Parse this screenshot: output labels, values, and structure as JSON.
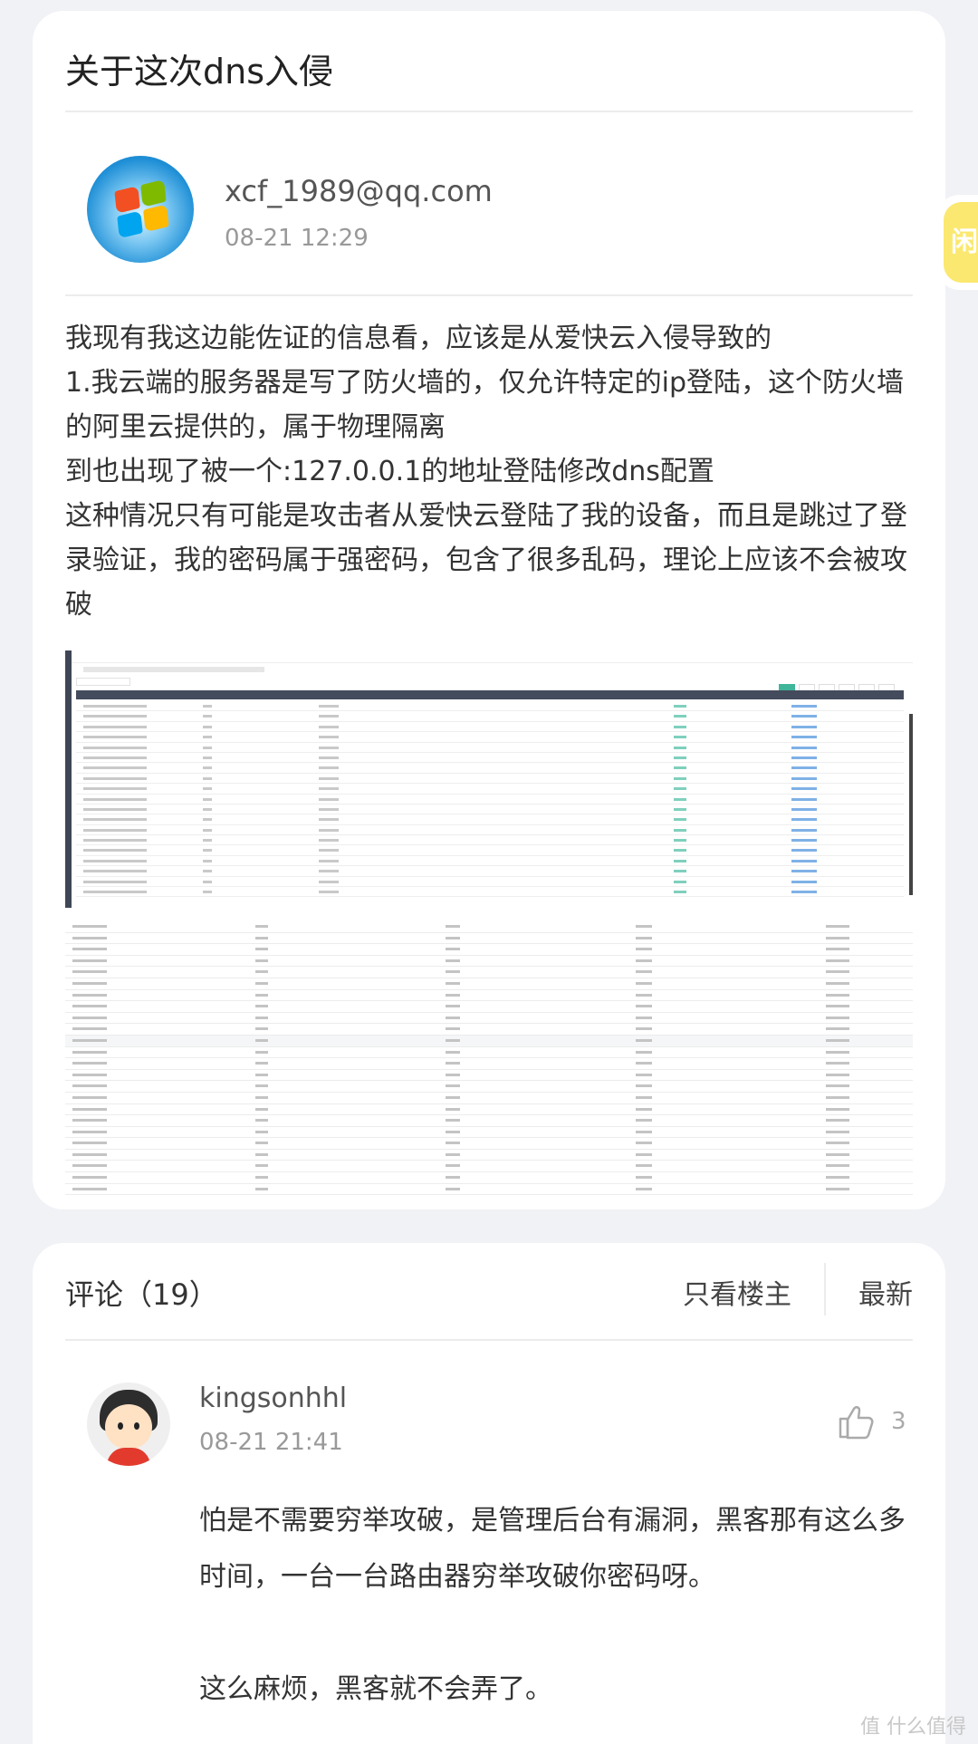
{
  "post": {
    "title": "关于这次dns入侵",
    "author": "xcf_1989@qq.com",
    "time": "08-21 12:29",
    "body": [
      "我现有我这边能佐证的信息看，应该是从爱快云入侵导致的",
      "1.我云端的服务器是写了防火墙的，仅允许特定的ip登陆，这个防火墙的阿里云提供的，属于物理隔离",
      "到也出现了被一个:127.0.0.1的地址登陆修改dns配置",
      "这种情况只有可能是攻击者从爱快云登陆了我的设备，而且是跳过了登录验证，我的密码属于强密码，包含了很多乱码，理论上应该不会被攻破"
    ]
  },
  "side_tab": {
    "label": "闲"
  },
  "comments": {
    "heading": "评论（19）",
    "filter_owner": "只看楼主",
    "filter_latest": "最新",
    "items": [
      {
        "author": "kingsonhhl",
        "time": "08-21 21:41",
        "likes": "3",
        "text": [
          "怕是不需要穷举攻破，是管理后台有漏洞，黑客那有这么多时间，一台一台路由器穷举攻破你密码呀。",
          "",
          "这么麻烦，黑客就不会弄了。"
        ]
      }
    ]
  },
  "watermark": "值 什么值得买",
  "icons": {
    "avatar_post": "windows-logo-avatar",
    "avatar_comment": "cartoon-boy-avatar",
    "like": "thumbs-up-icon"
  },
  "colors": {
    "page_bg": "#f1f2f6",
    "card_bg": "#ffffff",
    "side_tab": "#fbe870"
  }
}
